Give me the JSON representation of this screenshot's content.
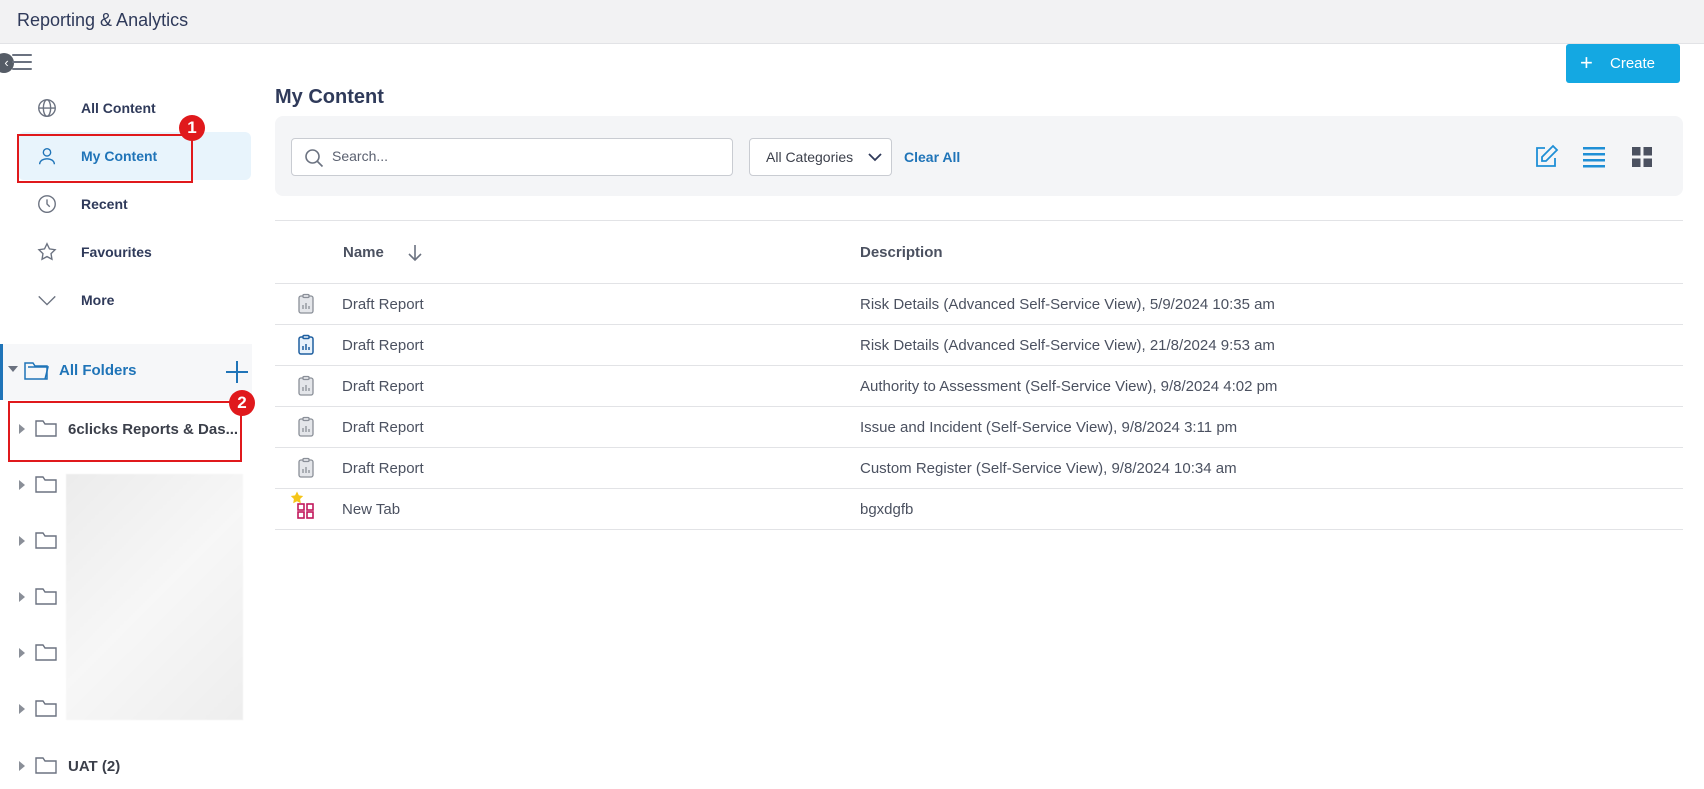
{
  "app": {
    "title": "Reporting & Analytics"
  },
  "sidebar": {
    "items": [
      {
        "label": "All Content",
        "icon": "globe-icon"
      },
      {
        "label": "My Content",
        "icon": "user-icon"
      },
      {
        "label": "Recent",
        "icon": "clock-icon"
      },
      {
        "label": "Favourites",
        "icon": "star-icon"
      },
      {
        "label": "More",
        "icon": "chevron-down-icon"
      }
    ],
    "folders_label": "All Folders",
    "folders": [
      {
        "label": "6clicks Reports & Das..."
      },
      {
        "label": ""
      },
      {
        "label": ""
      },
      {
        "label": ""
      },
      {
        "label": ""
      },
      {
        "label": ""
      },
      {
        "label": "UAT (2)"
      }
    ]
  },
  "annotations": {
    "badge1": "1",
    "badge2": "2"
  },
  "main": {
    "title": "My Content",
    "create_label": "Create",
    "search_placeholder": "Search...",
    "category_selected": "All Categories",
    "clear_all": "Clear All",
    "columns": {
      "name": "Name",
      "description": "Description"
    },
    "rows": [
      {
        "name": "Draft Report",
        "description": "Risk Details (Advanced Self-Service View), 5/9/2024 10:35 am",
        "icon": "report-icon"
      },
      {
        "name": "Draft Report",
        "description": "Risk Details (Advanced Self-Service View), 21/8/2024 9:53 am",
        "icon": "report-icon"
      },
      {
        "name": "Draft Report",
        "description": "Authority to Assessment (Self-Service View), 9/8/2024 4:02 pm",
        "icon": "report-icon"
      },
      {
        "name": "Draft Report",
        "description": "Issue and Incident (Self-Service View), 9/8/2024 3:11 pm",
        "icon": "report-icon"
      },
      {
        "name": "Draft Report",
        "description": "Custom Register (Self-Service View), 9/8/2024 10:34 am",
        "icon": "report-icon"
      },
      {
        "name": "New Tab",
        "description": "bgxdgfb",
        "icon": "dashboard-icon"
      }
    ]
  },
  "colors": {
    "accent": "#1f74b8",
    "create": "#14a8e2",
    "annotation": "#e0191c",
    "favourite": "#f5c518",
    "dashboard": "#c2185b"
  }
}
